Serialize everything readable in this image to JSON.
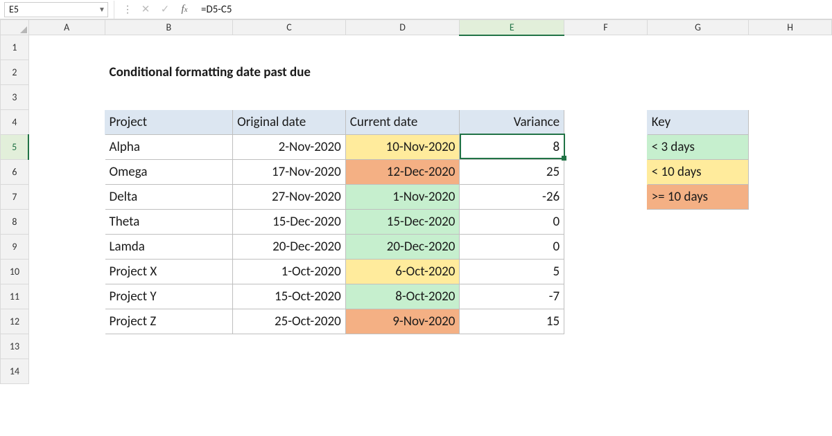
{
  "name_box": "E5",
  "formula": "=D5-C5",
  "title": "Conditional formatting date past due",
  "columns": [
    "A",
    "B",
    "C",
    "D",
    "E",
    "F",
    "G",
    "H"
  ],
  "rows": [
    "1",
    "2",
    "3",
    "4",
    "5",
    "6",
    "7",
    "8",
    "9",
    "10",
    "11",
    "12",
    "13",
    "14"
  ],
  "col_widths": {
    "row_hdr": 41,
    "A": 110,
    "B": 185,
    "C": 163,
    "D": 165,
    "E": 151,
    "F": 120,
    "G": 147,
    "H": 120
  },
  "headers": {
    "B4": "Project",
    "C4": "Original date",
    "D4": "Current date",
    "E4": "Variance",
    "G4": "Key"
  },
  "data": [
    {
      "project": "Alpha",
      "orig": "2-Nov-2020",
      "curr": "10-Nov-2020",
      "var": "8",
      "curr_cls": "yellow"
    },
    {
      "project": "Omega",
      "orig": "17-Nov-2020",
      "curr": "12-Dec-2020",
      "var": "25",
      "curr_cls": "orange"
    },
    {
      "project": "Delta",
      "orig": "27-Nov-2020",
      "curr": "1-Nov-2020",
      "var": "-26",
      "curr_cls": "green"
    },
    {
      "project": "Theta",
      "orig": "15-Dec-2020",
      "curr": "15-Dec-2020",
      "var": "0",
      "curr_cls": "green"
    },
    {
      "project": "Lamda",
      "orig": "20-Dec-2020",
      "curr": "20-Dec-2020",
      "var": "0",
      "curr_cls": "green"
    },
    {
      "project": "Project X",
      "orig": "1-Oct-2020",
      "curr": "6-Oct-2020",
      "var": "5",
      "curr_cls": "yellow"
    },
    {
      "project": "Project Y",
      "orig": "15-Oct-2020",
      "curr": "8-Oct-2020",
      "var": "-7",
      "curr_cls": "green"
    },
    {
      "project": "Project Z",
      "orig": "25-Oct-2020",
      "curr": "9-Nov-2020",
      "var": "15",
      "curr_cls": "orange"
    }
  ],
  "key": [
    {
      "label": "< 3 days",
      "cls": "green"
    },
    {
      "label": "< 10 days",
      "cls": "yellow"
    },
    {
      "label": ">= 10 days",
      "cls": "orange"
    }
  ],
  "selection": {
    "col": "E",
    "row": "5"
  }
}
